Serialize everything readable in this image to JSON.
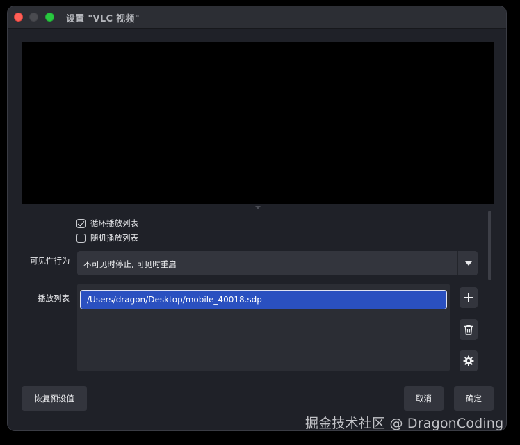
{
  "window": {
    "title": "设置 \"VLC 视频\""
  },
  "options": {
    "loop_label": "循环播放列表",
    "loop_checked": true,
    "shuffle_label": "随机播放列表",
    "shuffle_checked": false
  },
  "visibility": {
    "label": "可见性行为",
    "selected": "不可见时停止, 可见时重启"
  },
  "playlist": {
    "label": "播放列表",
    "items": [
      "/Users/dragon/Desktop/mobile_40018.sdp"
    ],
    "selected_index": 0
  },
  "playlist_actions": {
    "add_icon": "plus-icon",
    "remove_icon": "trash-icon",
    "settings_icon": "gear-icon"
  },
  "footer": {
    "restore_label": "恢复预设值",
    "cancel_label": "取消",
    "ok_label": "确定"
  },
  "watermark": "掘金技术社区 @ DragonCoding",
  "colors": {
    "window_bg": "#1f2128",
    "control_bg": "#33353d",
    "selection": "#2a50c0",
    "close": "#fe5f57",
    "maximize": "#29c840"
  }
}
